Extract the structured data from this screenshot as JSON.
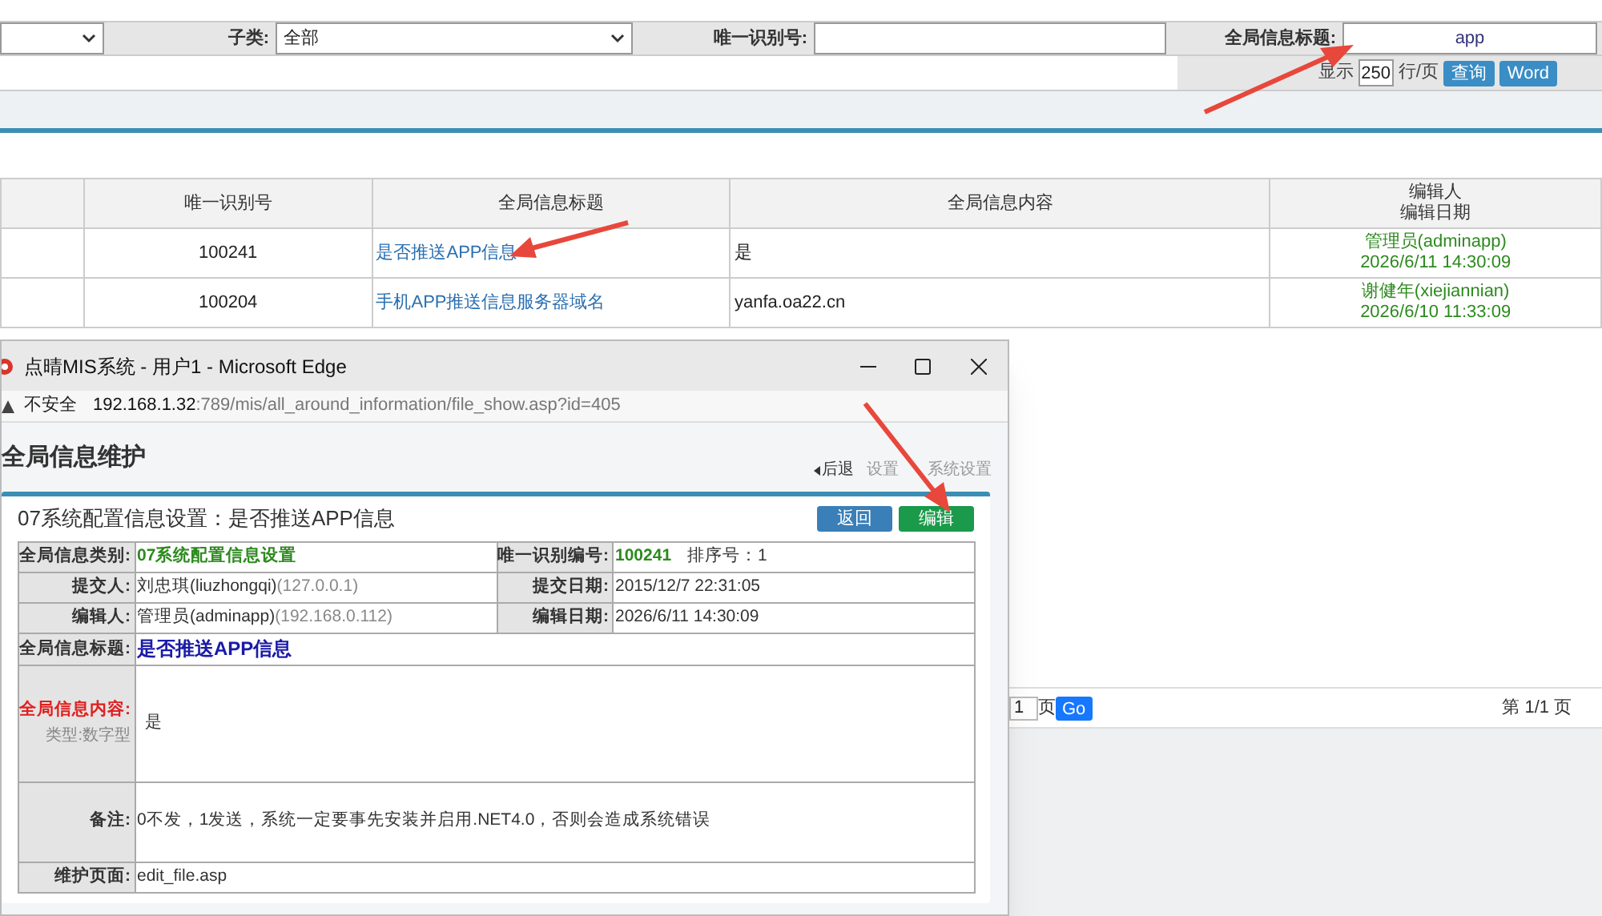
{
  "filters": [
    {
      "kind": "select",
      "label": "子类:",
      "value": "全部"
    },
    {
      "kind": "text",
      "label": "唯一识别号:"
    },
    {
      "kind": "text",
      "label": "全局信息标题:",
      "value": "app"
    }
  ],
  "page_size": {
    "prefix": "显示",
    "value": "250",
    "suffix": "行/页"
  },
  "search_buttons": [
    "查询",
    "Word"
  ],
  "table": {
    "columns": [
      {
        "label": "唯一识别号"
      },
      {
        "label": "全局信息标题"
      },
      {
        "label": "全局信息内容"
      },
      {
        "label": "编辑人",
        "sublabel": "编辑日期"
      }
    ],
    "rows": [
      {
        "id": "100241",
        "title": "是否推送APP信息",
        "content": "是",
        "editor": "管理员(adminapp)",
        "date": "2026/6/11 14:30:09"
      },
      {
        "id": "100204",
        "title": "手机APP推送信息服务器域名",
        "content": "yanfa.oa22.cn",
        "editor": "谢健年(xiejiannian)",
        "date": "2026/6/10 11:33:09"
      }
    ]
  },
  "pagination": {
    "page": "1",
    "page_suffix": "页",
    "go": "Go",
    "summary": "第 1/1 页"
  },
  "window": {
    "title": "点晴MIS系统 - 用户1 - Microsoft Edge",
    "address": {
      "warning": "不安全",
      "host": "192.168.1.32",
      "rest": ":789/mis/all_around_information/file_show.asp?id=405"
    },
    "heading": "全局信息维护",
    "breadcrumbs": [
      {
        "label": "后退"
      },
      {
        "label": "设置"
      },
      {
        "label": "系统设置"
      }
    ],
    "panel_title": "07系统配置信息设置：是否推送APP信息",
    "buttons": [
      {
        "label": "返回",
        "kind": "back"
      },
      {
        "label": "编辑",
        "kind": "edit"
      }
    ],
    "info_rows": [
      {
        "kind": "double",
        "left": {
          "label": "全局信息类别:",
          "value": "07系统配置信息设置",
          "color": "#2d8a1e"
        },
        "right": {
          "label": "唯一识别编号:",
          "value": "100241",
          "color": "#2d8a1e",
          "extra": "排序号：1"
        }
      },
      {
        "kind": "double",
        "left": {
          "label": "提交人:",
          "value": "刘忠琪(liuzhongqi)",
          "extra": "(127.0.0.1)"
        },
        "right": {
          "label": "提交日期:",
          "value": "2015/12/7 22:31:05"
        }
      },
      {
        "kind": "double",
        "left": {
          "label": "编辑人:",
          "value": "管理员(adminapp)",
          "extra": "(192.168.0.112)"
        },
        "right": {
          "label": "编辑日期:",
          "value": "2026/6/11 14:30:09"
        }
      },
      {
        "kind": "single",
        "label": "全局信息标题:",
        "value": "是否推送APP信息",
        "color": "#1a1aa8"
      },
      {
        "kind": "tall",
        "label": "全局信息内容:",
        "sublabel": "类型:数字型",
        "value": "是",
        "color": "#e02020"
      },
      {
        "kind": "medium",
        "label": "备注:",
        "value": "0不发，1发送，系统一定要事先安装并启用.NET4.0，否则会造成系统错误"
      },
      {
        "kind": "single",
        "label": "维护页面:",
        "value": "edit_file.asp"
      }
    ]
  }
}
